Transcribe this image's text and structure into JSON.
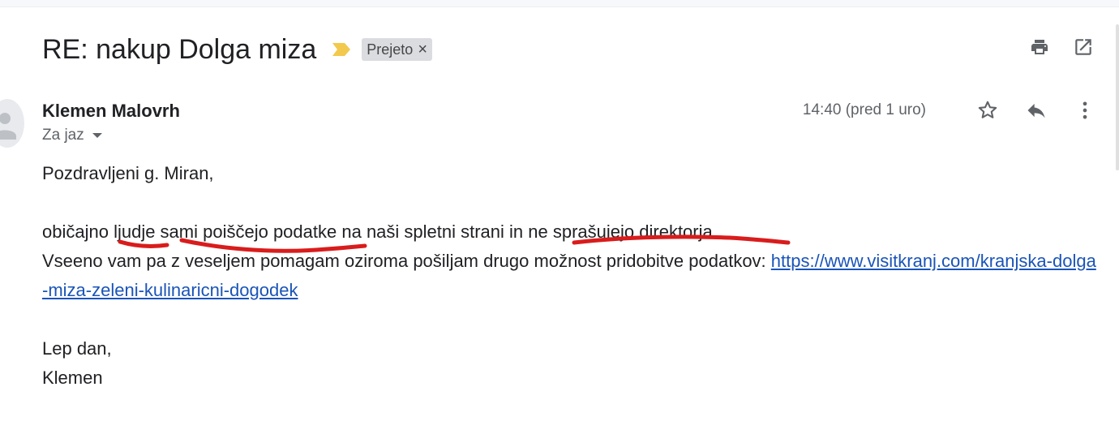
{
  "subject": "RE: nakup Dolga miza",
  "label": {
    "text": "Prejeto",
    "remove_glyph": "×"
  },
  "sender": {
    "name": "Klemen Malovrh",
    "recipient": "Za jaz"
  },
  "time": "14:40 (pred 1 uro)",
  "body": {
    "greeting": "Pozdravljeni g. Miran,",
    "line1": {
      "a": "običajno ",
      "b": "ljudje sami poiščejo podatke",
      "c": " na naši spletni strani in ",
      "d": "ne sprašujejo direktorja",
      "e": "."
    },
    "line2": "Vseeno vam pa z veseljem pomagam oziroma pošiljam drugo možnost pridobitve podatkov: ",
    "link": "https://www.visitkranj.com/kranjska-dolga-miza-zeleni-kulinaricni-dogodek",
    "closing": "Lep dan,",
    "signature": "Klemen"
  },
  "colors": {
    "annotation": "#d91c1c",
    "link": "#1a54b8",
    "importance": "#f2c94c"
  },
  "icons": {
    "importance": "importance-marker-icon",
    "print": "print-icon",
    "open_new": "open-in-new-window-icon",
    "star": "star-icon",
    "reply": "reply-icon",
    "more": "more-vert-icon",
    "avatar": "person-icon"
  }
}
